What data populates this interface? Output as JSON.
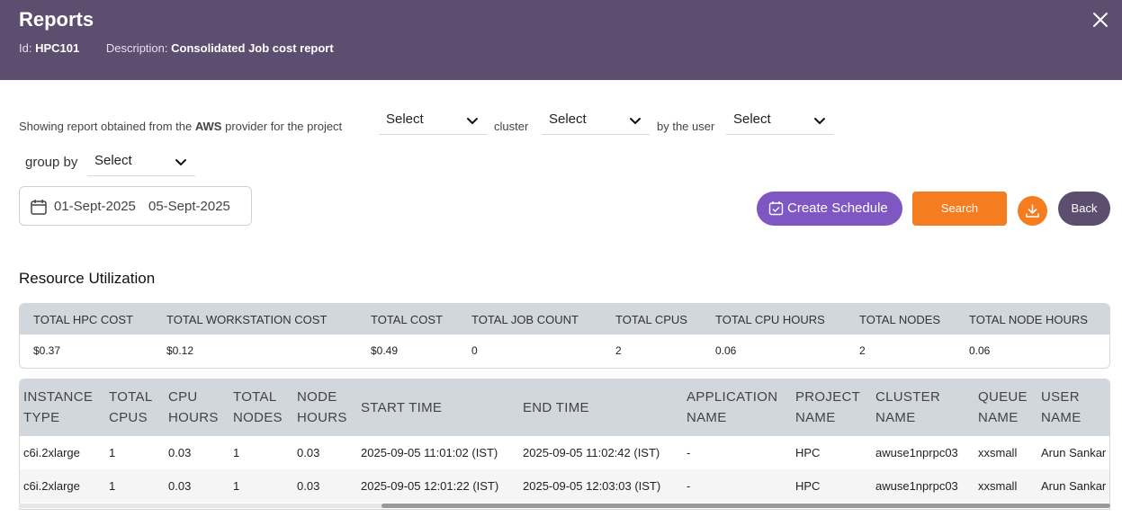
{
  "header": {
    "title": "Reports",
    "id_label": "Id:",
    "id_value": "HPC101",
    "description_label": "Description:",
    "description_value": "Consolidated Job cost report"
  },
  "filters": {
    "text_prefix": "Showing report obtained from the",
    "provider": "AWS",
    "text_provider_suffix": "provider for the project",
    "project_select": "Select",
    "text_cluster": "cluster",
    "cluster_select": "Select",
    "text_user": "by the user",
    "user_select": "Select",
    "group_by_label": "group by",
    "group_by_select": "Select"
  },
  "date_range": {
    "start": "01-Sept-2025",
    "end": "05-Sept-2025"
  },
  "actions": {
    "create_schedule": "Create Schedule",
    "search": "Search",
    "back": "Back"
  },
  "resource_utilization": {
    "title": "Resource Utilization",
    "headers": [
      "TOTAL HPC COST",
      "TOTAL WORKSTATION COST",
      "TOTAL COST",
      "TOTAL JOB COUNT",
      "TOTAL CPUS",
      "TOTAL CPU HOURS",
      "TOTAL NODES",
      "TOTAL NODE HOURS"
    ],
    "values": [
      "$0.37",
      "$0.12",
      "$0.49",
      "0",
      "2",
      "0.06",
      "2",
      "0.06"
    ]
  },
  "jobs_table": {
    "headers": [
      [
        "INSTANCE",
        "TYPE"
      ],
      [
        "TOTAL",
        "CPUS"
      ],
      [
        "CPU",
        "HOURS"
      ],
      [
        "TOTAL",
        "NODES"
      ],
      [
        "NODE",
        "HOURS"
      ],
      [
        "START TIME",
        ""
      ],
      [
        "END TIME",
        ""
      ],
      [
        "APPLICATION",
        "NAME"
      ],
      [
        "PROJECT",
        "NAME"
      ],
      [
        "CLUSTER",
        "NAME"
      ],
      [
        "QUEUE",
        "NAME"
      ],
      [
        "USER",
        "NAME"
      ]
    ],
    "rows": [
      [
        "c6i.2xlarge",
        "1",
        "0.03",
        "1",
        "0.03",
        "2025-09-05 11:01:02 (IST)",
        "2025-09-05 11:02:42 (IST)",
        "-",
        "HPC",
        "awuse1nprpc03",
        "xxsmall",
        "Arun Sankar"
      ],
      [
        "c6i.2xlarge",
        "1",
        "0.03",
        "1",
        "0.03",
        "2025-09-05 12:01:22 (IST)",
        "2025-09-05 12:03:03 (IST)",
        "-",
        "HPC",
        "awuse1nprpc03",
        "xxsmall",
        "Arun Sankar"
      ]
    ]
  },
  "icons": {
    "close": "close-icon",
    "calendar": "calendar-icon",
    "schedule": "calendar-check-icon",
    "download": "download-icon",
    "chevron": "chevron-down-icon"
  },
  "colors": {
    "header_bg": "#5d4e6f",
    "schedule_btn": "#7e57c2",
    "search_btn": "#f57c1f",
    "back_btn": "#5d4e6f",
    "table_header_bg": "#d2d6dd"
  }
}
